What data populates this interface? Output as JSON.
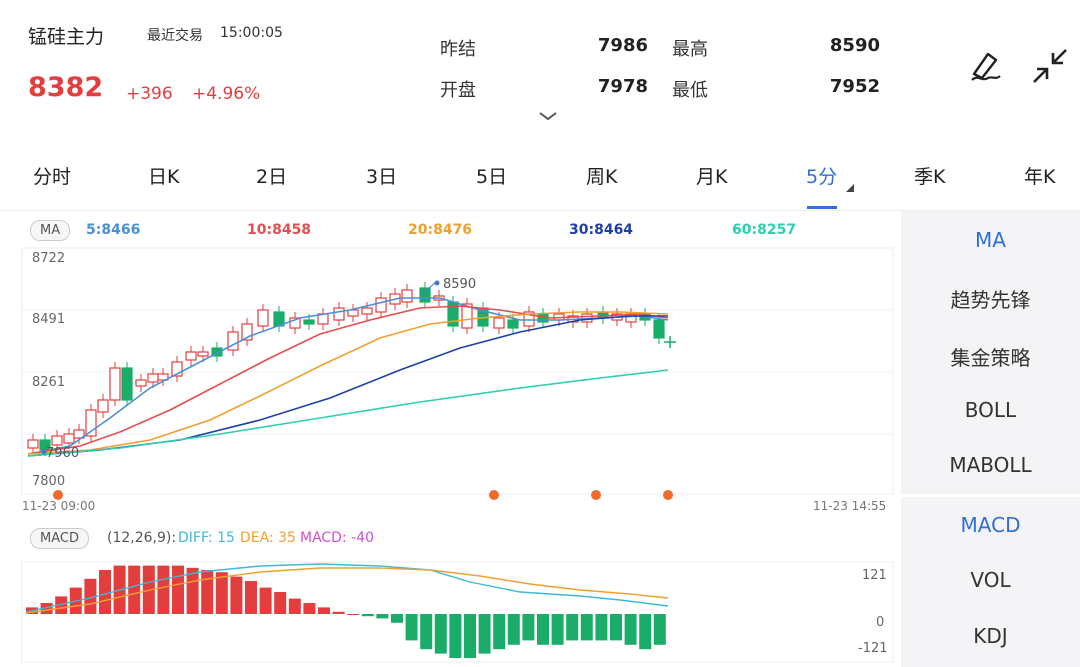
{
  "header": {
    "name": "锰硅主力",
    "recent_label": "最近交易",
    "time": "15:00:05",
    "price": "8382",
    "change": "+396",
    "change_pct": "+4.96%",
    "stats": {
      "prev_settle_label": "昨结",
      "prev_settle": "7986",
      "high_label": "最高",
      "high": "8590",
      "open_label": "开盘",
      "open": "7978",
      "low_label": "最低",
      "low": "7952"
    }
  },
  "tabs": [
    "分时",
    "日K",
    "2日",
    "3日",
    "5日",
    "周K",
    "月K",
    "5分",
    "季K",
    "年K"
  ],
  "active_tab": "5分",
  "side_menu": {
    "main": [
      "MA",
      "趋势先锋",
      "集金策略",
      "BOLL",
      "MABOLL"
    ],
    "sub": [
      "MACD",
      "VOL",
      "KDJ"
    ],
    "active_main": "MA",
    "active_sub": "MACD"
  },
  "ma_bar": {
    "pill": "MA",
    "ma5": "5:8466",
    "ma10": "10:8458",
    "ma20": "20:8476",
    "ma30": "30:8464",
    "ma60": "60:8257"
  },
  "price_axis": [
    "8722",
    "8491",
    "8261",
    "7800"
  ],
  "price_marks": {
    "high": "8590",
    "low": "7960"
  },
  "time_axis": {
    "start": "11-23 09:00",
    "end": "11-23 14:55"
  },
  "macd_bar": {
    "pill": "MACD",
    "params": "(12,26,9):",
    "diff": "DIFF: 15",
    "dea": "DEA: 35",
    "macd": "MACD: -40"
  },
  "macd_axis": [
    "121",
    "0",
    "-121"
  ],
  "colors": {
    "up": "#e23e3e",
    "down": "#1aad6a",
    "accent": "#2f6fd8",
    "ma5": "#4a90d9",
    "ma10": "#e05050",
    "ma20": "#f0a030",
    "ma30": "#1e3fa8",
    "ma60": "#2ed0b0",
    "diff": "#3fb8d8",
    "dea": "#f0a030",
    "macd_label": "#d050d0"
  },
  "icons": [
    "draw-pen-icon",
    "collapse-arrows-icon",
    "chevron-down-icon"
  ]
}
